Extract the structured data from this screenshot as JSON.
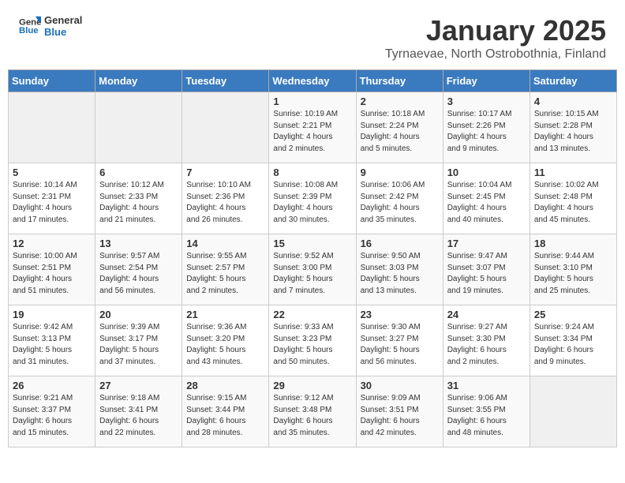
{
  "header": {
    "logo_line1": "General",
    "logo_line2": "Blue",
    "month": "January 2025",
    "location": "Tyrnaevae, North Ostrobothnia, Finland"
  },
  "weekdays": [
    "Sunday",
    "Monday",
    "Tuesday",
    "Wednesday",
    "Thursday",
    "Friday",
    "Saturday"
  ],
  "weeks": [
    [
      {
        "day": "",
        "info": ""
      },
      {
        "day": "",
        "info": ""
      },
      {
        "day": "",
        "info": ""
      },
      {
        "day": "1",
        "info": "Sunrise: 10:19 AM\nSunset: 2:21 PM\nDaylight: 4 hours\nand 2 minutes."
      },
      {
        "day": "2",
        "info": "Sunrise: 10:18 AM\nSunset: 2:24 PM\nDaylight: 4 hours\nand 5 minutes."
      },
      {
        "day": "3",
        "info": "Sunrise: 10:17 AM\nSunset: 2:26 PM\nDaylight: 4 hours\nand 9 minutes."
      },
      {
        "day": "4",
        "info": "Sunrise: 10:15 AM\nSunset: 2:28 PM\nDaylight: 4 hours\nand 13 minutes."
      }
    ],
    [
      {
        "day": "5",
        "info": "Sunrise: 10:14 AM\nSunset: 2:31 PM\nDaylight: 4 hours\nand 17 minutes."
      },
      {
        "day": "6",
        "info": "Sunrise: 10:12 AM\nSunset: 2:33 PM\nDaylight: 4 hours\nand 21 minutes."
      },
      {
        "day": "7",
        "info": "Sunrise: 10:10 AM\nSunset: 2:36 PM\nDaylight: 4 hours\nand 26 minutes."
      },
      {
        "day": "8",
        "info": "Sunrise: 10:08 AM\nSunset: 2:39 PM\nDaylight: 4 hours\nand 30 minutes."
      },
      {
        "day": "9",
        "info": "Sunrise: 10:06 AM\nSunset: 2:42 PM\nDaylight: 4 hours\nand 35 minutes."
      },
      {
        "day": "10",
        "info": "Sunrise: 10:04 AM\nSunset: 2:45 PM\nDaylight: 4 hours\nand 40 minutes."
      },
      {
        "day": "11",
        "info": "Sunrise: 10:02 AM\nSunset: 2:48 PM\nDaylight: 4 hours\nand 45 minutes."
      }
    ],
    [
      {
        "day": "12",
        "info": "Sunrise: 10:00 AM\nSunset: 2:51 PM\nDaylight: 4 hours\nand 51 minutes."
      },
      {
        "day": "13",
        "info": "Sunrise: 9:57 AM\nSunset: 2:54 PM\nDaylight: 4 hours\nand 56 minutes."
      },
      {
        "day": "14",
        "info": "Sunrise: 9:55 AM\nSunset: 2:57 PM\nDaylight: 5 hours\nand 2 minutes."
      },
      {
        "day": "15",
        "info": "Sunrise: 9:52 AM\nSunset: 3:00 PM\nDaylight: 5 hours\nand 7 minutes."
      },
      {
        "day": "16",
        "info": "Sunrise: 9:50 AM\nSunset: 3:03 PM\nDaylight: 5 hours\nand 13 minutes."
      },
      {
        "day": "17",
        "info": "Sunrise: 9:47 AM\nSunset: 3:07 PM\nDaylight: 5 hours\nand 19 minutes."
      },
      {
        "day": "18",
        "info": "Sunrise: 9:44 AM\nSunset: 3:10 PM\nDaylight: 5 hours\nand 25 minutes."
      }
    ],
    [
      {
        "day": "19",
        "info": "Sunrise: 9:42 AM\nSunset: 3:13 PM\nDaylight: 5 hours\nand 31 minutes."
      },
      {
        "day": "20",
        "info": "Sunrise: 9:39 AM\nSunset: 3:17 PM\nDaylight: 5 hours\nand 37 minutes."
      },
      {
        "day": "21",
        "info": "Sunrise: 9:36 AM\nSunset: 3:20 PM\nDaylight: 5 hours\nand 43 minutes."
      },
      {
        "day": "22",
        "info": "Sunrise: 9:33 AM\nSunset: 3:23 PM\nDaylight: 5 hours\nand 50 minutes."
      },
      {
        "day": "23",
        "info": "Sunrise: 9:30 AM\nSunset: 3:27 PM\nDaylight: 5 hours\nand 56 minutes."
      },
      {
        "day": "24",
        "info": "Sunrise: 9:27 AM\nSunset: 3:30 PM\nDaylight: 6 hours\nand 2 minutes."
      },
      {
        "day": "25",
        "info": "Sunrise: 9:24 AM\nSunset: 3:34 PM\nDaylight: 6 hours\nand 9 minutes."
      }
    ],
    [
      {
        "day": "26",
        "info": "Sunrise: 9:21 AM\nSunset: 3:37 PM\nDaylight: 6 hours\nand 15 minutes."
      },
      {
        "day": "27",
        "info": "Sunrise: 9:18 AM\nSunset: 3:41 PM\nDaylight: 6 hours\nand 22 minutes."
      },
      {
        "day": "28",
        "info": "Sunrise: 9:15 AM\nSunset: 3:44 PM\nDaylight: 6 hours\nand 28 minutes."
      },
      {
        "day": "29",
        "info": "Sunrise: 9:12 AM\nSunset: 3:48 PM\nDaylight: 6 hours\nand 35 minutes."
      },
      {
        "day": "30",
        "info": "Sunrise: 9:09 AM\nSunset: 3:51 PM\nDaylight: 6 hours\nand 42 minutes."
      },
      {
        "day": "31",
        "info": "Sunrise: 9:06 AM\nSunset: 3:55 PM\nDaylight: 6 hours\nand 48 minutes."
      },
      {
        "day": "",
        "info": ""
      }
    ]
  ]
}
